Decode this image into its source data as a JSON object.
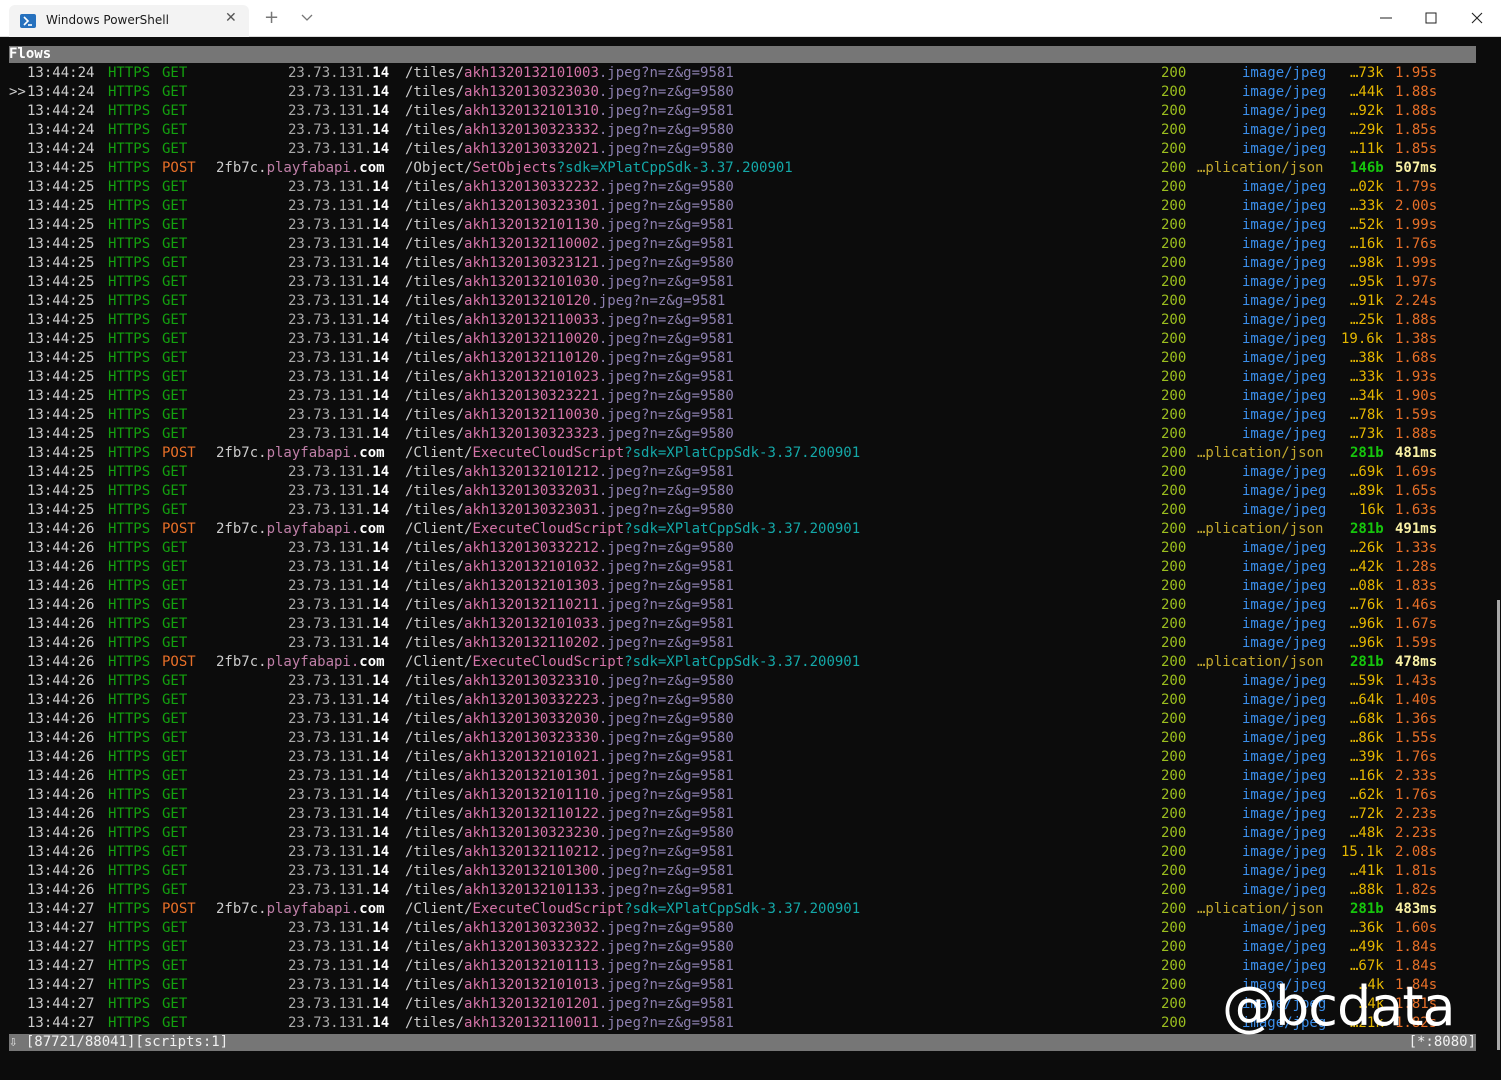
{
  "window": {
    "tab_title": "Windows PowerShell",
    "tab_close": "✕",
    "new_tab": "+",
    "tab_icon": "powershell-icon",
    "controls": [
      "minimize-icon",
      "maximize-icon",
      "close-icon"
    ]
  },
  "terminal": {
    "header": "Flows",
    "status_left": "⇩ [87721/88041][scripts:1]",
    "status_right": "[*:8080]",
    "watermark": "@bcdata",
    "flows": [
      {
        "sel": "",
        "t": "13:44:24",
        "m": "GET",
        "h": "23.73.131.14",
        "path": "/tiles/akh1320132101003.jpeg?n=z&g=9581",
        "st": "200",
        "ct": "image/jpeg",
        "sz": "…73k",
        "tm": "1.95s"
      },
      {
        "sel": ">>",
        "t": "13:44:24",
        "m": "GET",
        "h": "23.73.131.14",
        "path": "/tiles/akh1320130323030.jpeg?n=z&g=9580",
        "st": "200",
        "ct": "image/jpeg",
        "sz": "…44k",
        "tm": "1.88s"
      },
      {
        "sel": "",
        "t": "13:44:24",
        "m": "GET",
        "h": "23.73.131.14",
        "path": "/tiles/akh1320132101310.jpeg?n=z&g=9581",
        "st": "200",
        "ct": "image/jpeg",
        "sz": "…92k",
        "tm": "1.88s"
      },
      {
        "sel": "",
        "t": "13:44:24",
        "m": "GET",
        "h": "23.73.131.14",
        "path": "/tiles/akh1320130323332.jpeg?n=z&g=9580",
        "st": "200",
        "ct": "image/jpeg",
        "sz": "…29k",
        "tm": "1.85s"
      },
      {
        "sel": "",
        "t": "13:44:24",
        "m": "GET",
        "h": "23.73.131.14",
        "path": "/tiles/akh1320130332021.jpeg?n=z&g=9580",
        "st": "200",
        "ct": "image/jpeg",
        "sz": "…11k",
        "tm": "1.85s"
      },
      {
        "sel": "",
        "t": "13:44:25",
        "m": "POST",
        "h": "2fb7c.playfabapi.com",
        "path": "/Object/SetObjects?sdk=XPlatCppSdk-3.37.200901",
        "st": "200",
        "ct": "…plication/json",
        "sz": "146b",
        "tm": "507ms"
      },
      {
        "sel": "",
        "t": "13:44:25",
        "m": "GET",
        "h": "23.73.131.14",
        "path": "/tiles/akh1320130332232.jpeg?n=z&g=9580",
        "st": "200",
        "ct": "image/jpeg",
        "sz": "…02k",
        "tm": "1.79s"
      },
      {
        "sel": "",
        "t": "13:44:25",
        "m": "GET",
        "h": "23.73.131.14",
        "path": "/tiles/akh1320130323301.jpeg?n=z&g=9580",
        "st": "200",
        "ct": "image/jpeg",
        "sz": "…33k",
        "tm": "2.00s"
      },
      {
        "sel": "",
        "t": "13:44:25",
        "m": "GET",
        "h": "23.73.131.14",
        "path": "/tiles/akh1320132101130.jpeg?n=z&g=9581",
        "st": "200",
        "ct": "image/jpeg",
        "sz": "…52k",
        "tm": "1.99s"
      },
      {
        "sel": "",
        "t": "13:44:25",
        "m": "GET",
        "h": "23.73.131.14",
        "path": "/tiles/akh1320132110002.jpeg?n=z&g=9581",
        "st": "200",
        "ct": "image/jpeg",
        "sz": "…16k",
        "tm": "1.76s"
      },
      {
        "sel": "",
        "t": "13:44:25",
        "m": "GET",
        "h": "23.73.131.14",
        "path": "/tiles/akh1320130323121.jpeg?n=z&g=9580",
        "st": "200",
        "ct": "image/jpeg",
        "sz": "…98k",
        "tm": "1.99s"
      },
      {
        "sel": "",
        "t": "13:44:25",
        "m": "GET",
        "h": "23.73.131.14",
        "path": "/tiles/akh1320132101030.jpeg?n=z&g=9581",
        "st": "200",
        "ct": "image/jpeg",
        "sz": "…95k",
        "tm": "1.97s"
      },
      {
        "sel": "",
        "t": "13:44:25",
        "m": "GET",
        "h": "23.73.131.14",
        "path": "/tiles/akh132013210120.jpeg?n=z&g=9581",
        "st": "200",
        "ct": "image/jpeg",
        "sz": "…91k",
        "tm": "2.24s"
      },
      {
        "sel": "",
        "t": "13:44:25",
        "m": "GET",
        "h": "23.73.131.14",
        "path": "/tiles/akh1320132110033.jpeg?n=z&g=9581",
        "st": "200",
        "ct": "image/jpeg",
        "sz": "…25k",
        "tm": "1.88s"
      },
      {
        "sel": "",
        "t": "13:44:25",
        "m": "GET",
        "h": "23.73.131.14",
        "path": "/tiles/akh1320132110020.jpeg?n=z&g=9581",
        "st": "200",
        "ct": "image/jpeg",
        "sz": "19.6k",
        "tm": "1.38s"
      },
      {
        "sel": "",
        "t": "13:44:25",
        "m": "GET",
        "h": "23.73.131.14",
        "path": "/tiles/akh1320132110120.jpeg?n=z&g=9581",
        "st": "200",
        "ct": "image/jpeg",
        "sz": "…38k",
        "tm": "1.68s"
      },
      {
        "sel": "",
        "t": "13:44:25",
        "m": "GET",
        "h": "23.73.131.14",
        "path": "/tiles/akh1320132101023.jpeg?n=z&g=9581",
        "st": "200",
        "ct": "image/jpeg",
        "sz": "…33k",
        "tm": "1.93s"
      },
      {
        "sel": "",
        "t": "13:44:25",
        "m": "GET",
        "h": "23.73.131.14",
        "path": "/tiles/akh1320130323221.jpeg?n=z&g=9580",
        "st": "200",
        "ct": "image/jpeg",
        "sz": "…34k",
        "tm": "1.90s"
      },
      {
        "sel": "",
        "t": "13:44:25",
        "m": "GET",
        "h": "23.73.131.14",
        "path": "/tiles/akh1320132110030.jpeg?n=z&g=9581",
        "st": "200",
        "ct": "image/jpeg",
        "sz": "…78k",
        "tm": "1.59s"
      },
      {
        "sel": "",
        "t": "13:44:25",
        "m": "GET",
        "h": "23.73.131.14",
        "path": "/tiles/akh1320130323323.jpeg?n=z&g=9580",
        "st": "200",
        "ct": "image/jpeg",
        "sz": "…73k",
        "tm": "1.88s"
      },
      {
        "sel": "",
        "t": "13:44:25",
        "m": "POST",
        "h": "2fb7c.playfabapi.com",
        "path": "/Client/ExecuteCloudScript?sdk=XPlatCppSdk-3.37.200901",
        "st": "200",
        "ct": "…plication/json",
        "sz": "281b",
        "tm": "481ms"
      },
      {
        "sel": "",
        "t": "13:44:25",
        "m": "GET",
        "h": "23.73.131.14",
        "path": "/tiles/akh1320132101212.jpeg?n=z&g=9581",
        "st": "200",
        "ct": "image/jpeg",
        "sz": "…69k",
        "tm": "1.69s"
      },
      {
        "sel": "",
        "t": "13:44:25",
        "m": "GET",
        "h": "23.73.131.14",
        "path": "/tiles/akh1320130332031.jpeg?n=z&g=9580",
        "st": "200",
        "ct": "image/jpeg",
        "sz": "…89k",
        "tm": "1.65s"
      },
      {
        "sel": "",
        "t": "13:44:25",
        "m": "GET",
        "h": "23.73.131.14",
        "path": "/tiles/akh1320130323031.jpeg?n=z&g=9580",
        "st": "200",
        "ct": "image/jpeg",
        "sz": "16k",
        "tm": "1.63s"
      },
      {
        "sel": "",
        "t": "13:44:26",
        "m": "POST",
        "h": "2fb7c.playfabapi.com",
        "path": "/Client/ExecuteCloudScript?sdk=XPlatCppSdk-3.37.200901",
        "st": "200",
        "ct": "…plication/json",
        "sz": "281b",
        "tm": "491ms"
      },
      {
        "sel": "",
        "t": "13:44:26",
        "m": "GET",
        "h": "23.73.131.14",
        "path": "/tiles/akh1320130332212.jpeg?n=z&g=9580",
        "st": "200",
        "ct": "image/jpeg",
        "sz": "…26k",
        "tm": "1.33s"
      },
      {
        "sel": "",
        "t": "13:44:26",
        "m": "GET",
        "h": "23.73.131.14",
        "path": "/tiles/akh1320132101032.jpeg?n=z&g=9581",
        "st": "200",
        "ct": "image/jpeg",
        "sz": "…42k",
        "tm": "1.28s"
      },
      {
        "sel": "",
        "t": "13:44:26",
        "m": "GET",
        "h": "23.73.131.14",
        "path": "/tiles/akh1320132101303.jpeg?n=z&g=9581",
        "st": "200",
        "ct": "image/jpeg",
        "sz": "…08k",
        "tm": "1.83s"
      },
      {
        "sel": "",
        "t": "13:44:26",
        "m": "GET",
        "h": "23.73.131.14",
        "path": "/tiles/akh1320132110211.jpeg?n=z&g=9581",
        "st": "200",
        "ct": "image/jpeg",
        "sz": "…76k",
        "tm": "1.46s"
      },
      {
        "sel": "",
        "t": "13:44:26",
        "m": "GET",
        "h": "23.73.131.14",
        "path": "/tiles/akh1320132101033.jpeg?n=z&g=9581",
        "st": "200",
        "ct": "image/jpeg",
        "sz": "…96k",
        "tm": "1.67s"
      },
      {
        "sel": "",
        "t": "13:44:26",
        "m": "GET",
        "h": "23.73.131.14",
        "path": "/tiles/akh1320132110202.jpeg?n=z&g=9581",
        "st": "200",
        "ct": "image/jpeg",
        "sz": "…96k",
        "tm": "1.59s"
      },
      {
        "sel": "",
        "t": "13:44:26",
        "m": "POST",
        "h": "2fb7c.playfabapi.com",
        "path": "/Client/ExecuteCloudScript?sdk=XPlatCppSdk-3.37.200901",
        "st": "200",
        "ct": "…plication/json",
        "sz": "281b",
        "tm": "478ms"
      },
      {
        "sel": "",
        "t": "13:44:26",
        "m": "GET",
        "h": "23.73.131.14",
        "path": "/tiles/akh1320130323310.jpeg?n=z&g=9580",
        "st": "200",
        "ct": "image/jpeg",
        "sz": "…59k",
        "tm": "1.43s"
      },
      {
        "sel": "",
        "t": "13:44:26",
        "m": "GET",
        "h": "23.73.131.14",
        "path": "/tiles/akh1320130332223.jpeg?n=z&g=9580",
        "st": "200",
        "ct": "image/jpeg",
        "sz": "…64k",
        "tm": "1.40s"
      },
      {
        "sel": "",
        "t": "13:44:26",
        "m": "GET",
        "h": "23.73.131.14",
        "path": "/tiles/akh1320130332030.jpeg?n=z&g=9580",
        "st": "200",
        "ct": "image/jpeg",
        "sz": "…68k",
        "tm": "1.36s"
      },
      {
        "sel": "",
        "t": "13:44:26",
        "m": "GET",
        "h": "23.73.131.14",
        "path": "/tiles/akh1320130323330.jpeg?n=z&g=9580",
        "st": "200",
        "ct": "image/jpeg",
        "sz": "…86k",
        "tm": "1.55s"
      },
      {
        "sel": "",
        "t": "13:44:26",
        "m": "GET",
        "h": "23.73.131.14",
        "path": "/tiles/akh1320132101021.jpeg?n=z&g=9581",
        "st": "200",
        "ct": "image/jpeg",
        "sz": "…39k",
        "tm": "1.76s"
      },
      {
        "sel": "",
        "t": "13:44:26",
        "m": "GET",
        "h": "23.73.131.14",
        "path": "/tiles/akh1320132101301.jpeg?n=z&g=9581",
        "st": "200",
        "ct": "image/jpeg",
        "sz": "…16k",
        "tm": "2.33s"
      },
      {
        "sel": "",
        "t": "13:44:26",
        "m": "GET",
        "h": "23.73.131.14",
        "path": "/tiles/akh1320132101110.jpeg?n=z&g=9581",
        "st": "200",
        "ct": "image/jpeg",
        "sz": "…62k",
        "tm": "1.76s"
      },
      {
        "sel": "",
        "t": "13:44:26",
        "m": "GET",
        "h": "23.73.131.14",
        "path": "/tiles/akh1320132110122.jpeg?n=z&g=9581",
        "st": "200",
        "ct": "image/jpeg",
        "sz": "…72k",
        "tm": "2.23s"
      },
      {
        "sel": "",
        "t": "13:44:26",
        "m": "GET",
        "h": "23.73.131.14",
        "path": "/tiles/akh1320130323230.jpeg?n=z&g=9580",
        "st": "200",
        "ct": "image/jpeg",
        "sz": "…48k",
        "tm": "2.23s"
      },
      {
        "sel": "",
        "t": "13:44:26",
        "m": "GET",
        "h": "23.73.131.14",
        "path": "/tiles/akh1320132110212.jpeg?n=z&g=9581",
        "st": "200",
        "ct": "image/jpeg",
        "sz": "15.1k",
        "tm": "2.08s"
      },
      {
        "sel": "",
        "t": "13:44:26",
        "m": "GET",
        "h": "23.73.131.14",
        "path": "/tiles/akh1320132101300.jpeg?n=z&g=9581",
        "st": "200",
        "ct": "image/jpeg",
        "sz": "…41k",
        "tm": "1.81s"
      },
      {
        "sel": "",
        "t": "13:44:26",
        "m": "GET",
        "h": "23.73.131.14",
        "path": "/tiles/akh1320132101133.jpeg?n=z&g=9581",
        "st": "200",
        "ct": "image/jpeg",
        "sz": "…88k",
        "tm": "1.82s"
      },
      {
        "sel": "",
        "t": "13:44:27",
        "m": "POST",
        "h": "2fb7c.playfabapi.com",
        "path": "/Client/ExecuteCloudScript?sdk=XPlatCppSdk-3.37.200901",
        "st": "200",
        "ct": "…plication/json",
        "sz": "281b",
        "tm": "483ms"
      },
      {
        "sel": "",
        "t": "13:44:27",
        "m": "GET",
        "h": "23.73.131.14",
        "path": "/tiles/akh1320130323032.jpeg?n=z&g=9580",
        "st": "200",
        "ct": "image/jpeg",
        "sz": "…36k",
        "tm": "1.60s"
      },
      {
        "sel": "",
        "t": "13:44:27",
        "m": "GET",
        "h": "23.73.131.14",
        "path": "/tiles/akh1320130332322.jpeg?n=z&g=9580",
        "st": "200",
        "ct": "image/jpeg",
        "sz": "…49k",
        "tm": "1.84s"
      },
      {
        "sel": "",
        "t": "13:44:27",
        "m": "GET",
        "h": "23.73.131.14",
        "path": "/tiles/akh1320132101113.jpeg?n=z&g=9581",
        "st": "200",
        "ct": "image/jpeg",
        "sz": "…67k",
        "tm": "1.84s"
      },
      {
        "sel": "",
        "t": "13:44:27",
        "m": "GET",
        "h": "23.73.131.14",
        "path": "/tiles/akh1320132101013.jpeg?n=z&g=9581",
        "st": "200",
        "ct": "image/jpeg",
        "sz": "…4k",
        "tm": "1.84s"
      },
      {
        "sel": "",
        "t": "13:44:27",
        "m": "GET",
        "h": "23.73.131.14",
        "path": "/tiles/akh1320132101201.jpeg?n=z&g=9581",
        "st": "200",
        "ct": "image/jpeg",
        "sz": "…4k",
        "tm": "1.81s"
      },
      {
        "sel": "",
        "t": "13:44:27",
        "m": "GET",
        "h": "23.73.131.14",
        "path": "/tiles/akh1320132110011.jpeg?n=z&g=9581",
        "st": "200",
        "ct": "image/jpeg",
        "sz": "…21k",
        "tm": "1.82s"
      }
    ]
  }
}
